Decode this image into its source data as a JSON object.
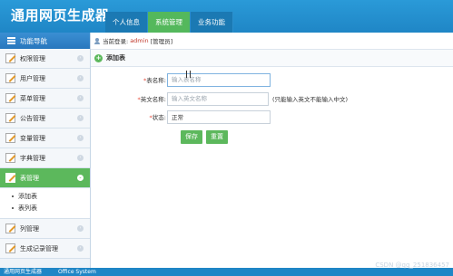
{
  "app": {
    "title": "通用网页生成器"
  },
  "nav": {
    "tabs": [
      "个人信息",
      "系统管理",
      "业务功能"
    ]
  },
  "sidebar": {
    "heading": "功能导航",
    "items": [
      {
        "label": "权限管理"
      },
      {
        "label": "用户管理"
      },
      {
        "label": "菜单管理"
      },
      {
        "label": "公告管理"
      },
      {
        "label": "变量管理"
      },
      {
        "label": "字典管理"
      },
      {
        "label": "表管理"
      },
      {
        "label": "列管理"
      },
      {
        "label": "生成记录管理"
      }
    ],
    "sub_items": [
      {
        "label": "添加表"
      },
      {
        "label": "表列表"
      }
    ]
  },
  "login": {
    "label": "当前登录:",
    "user": "admin",
    "role": "[管理员]"
  },
  "panel": {
    "title": "添加表"
  },
  "form": {
    "table_name": {
      "label": "表名称:",
      "placeholder": "输入表名称"
    },
    "english_name": {
      "label": "英文名称:",
      "placeholder": "输入英文名称",
      "hint": "(只能输入英文不能输入中文)"
    },
    "status": {
      "label": "状态:",
      "value": "正常"
    },
    "save_label": "保存",
    "reset_label": "重置"
  },
  "footer": {
    "left": "通用网页生成器",
    "right": "Office System",
    "watermark": "CSDN @qq_251836457"
  },
  "colors": {
    "header": "#1f86c6",
    "accent_green": "#5cb85c",
    "required": "#e74c3c"
  }
}
